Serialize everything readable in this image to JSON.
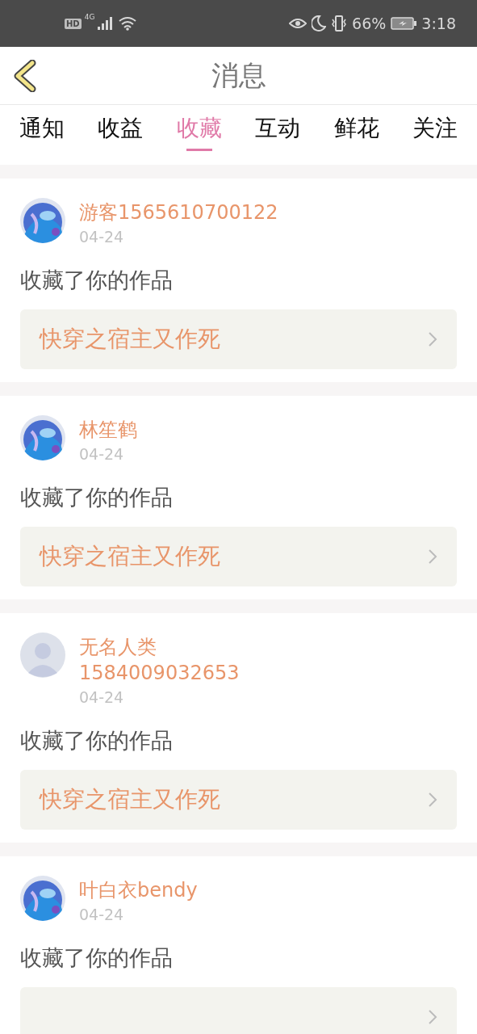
{
  "status_bar": {
    "hd_badge": "HD",
    "network": "4G",
    "battery": "66%",
    "time": "3:18"
  },
  "header": {
    "title": "消息"
  },
  "tabs": [
    {
      "label": "通知",
      "selected": false
    },
    {
      "label": "收益",
      "selected": false
    },
    {
      "label": "收藏",
      "selected": true
    },
    {
      "label": "互动",
      "selected": false
    },
    {
      "label": "鲜花",
      "selected": false
    },
    {
      "label": "关注",
      "selected": false
    }
  ],
  "messages": [
    {
      "name": "游客1565610700122",
      "date": "04-24",
      "action": "收藏了你的作品",
      "work": "快穿之宿主又作死"
    },
    {
      "name": "林笙鹤",
      "date": "04-24",
      "action": "收藏了你的作品",
      "work": "快穿之宿主又作死"
    },
    {
      "avatar": {
        "kind": "default"
      },
      "name": "无名人类1584009032653",
      "date": "04-24",
      "action": "收藏了你的作品",
      "work": "快穿之宿主又作死"
    },
    {
      "name": "叶白衣bendy",
      "date": "04-24",
      "action": "收藏了你的作品"
    }
  ]
}
